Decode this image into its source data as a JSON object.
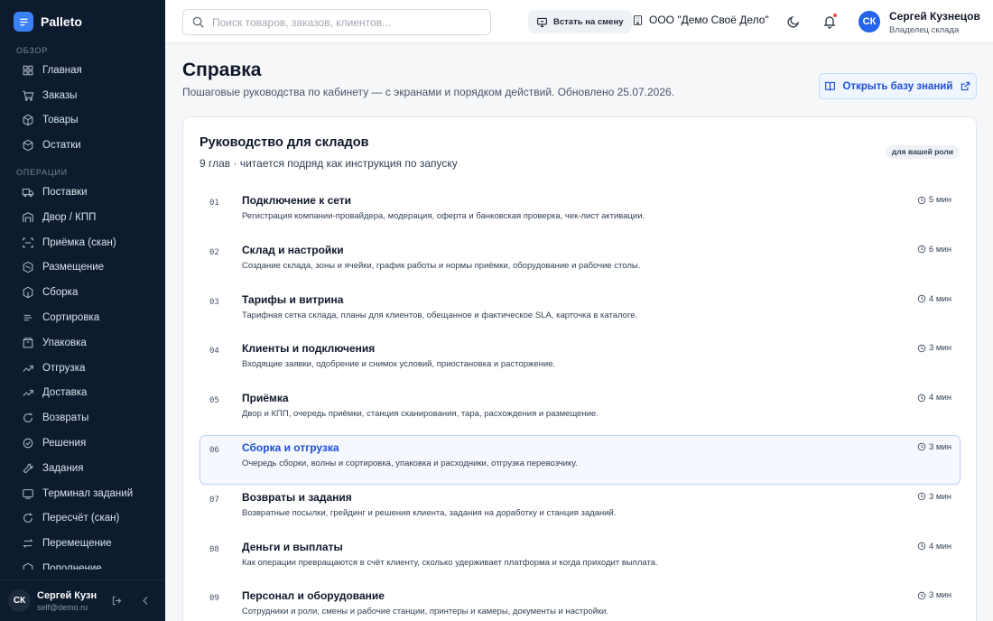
{
  "app": {
    "name": "Palleto"
  },
  "sidebar": {
    "sections": [
      {
        "label": "ОБЗОР",
        "items": [
          {
            "label": "Главная",
            "icon": "home-icon"
          },
          {
            "label": "Заказы",
            "icon": "cart-icon"
          },
          {
            "label": "Товары",
            "icon": "box-icon"
          },
          {
            "label": "Остатки",
            "icon": "stock-icon"
          }
        ]
      },
      {
        "label": "ОПЕРАЦИИ",
        "items": [
          {
            "label": "Поставки",
            "icon": "truck-icon"
          },
          {
            "label": "Двор / КПП",
            "icon": "gate-icon"
          },
          {
            "label": "Приёмка (скан)",
            "icon": "scan-icon"
          },
          {
            "label": "Размещение",
            "icon": "placement-icon"
          },
          {
            "label": "Сборка",
            "icon": "picking-icon"
          },
          {
            "label": "Сортировка",
            "icon": "sort-icon"
          },
          {
            "label": "Упаковка",
            "icon": "package-icon"
          },
          {
            "label": "Отгрузка",
            "icon": "shipment-icon"
          },
          {
            "label": "Доставка",
            "icon": "delivery-icon"
          },
          {
            "label": "Возвраты",
            "icon": "return-icon"
          },
          {
            "label": "Решения",
            "icon": "decision-icon"
          },
          {
            "label": "Задания",
            "icon": "task-icon"
          },
          {
            "label": "Терминал заданий",
            "icon": "terminal-icon"
          },
          {
            "label": "Пересчёт (скан)",
            "icon": "recount-icon"
          },
          {
            "label": "Перемещение",
            "icon": "transfer-icon"
          },
          {
            "label": "Пополнение",
            "icon": "replenish-icon"
          }
        ]
      }
    ],
    "user": {
      "initials": "СК",
      "name": "Сергей Кузнецов",
      "email": "self@demo.ru"
    }
  },
  "topbar": {
    "search_placeholder": "Поиск товаров, заказов, клиентов...",
    "shift_button": "Встать на смену",
    "org_name": "ООО \"Демо Своё Дело\"",
    "user": {
      "initials": "СК",
      "name": "Сергей Кузнецов",
      "role": "Владелец склада"
    }
  },
  "page": {
    "title": "Справка",
    "subtitle": "Пошаговые руководства по кабинету — с экранами и порядком действий. Обновлено 25.07.2026.",
    "kb_button": "Открыть базу знаний"
  },
  "guide": {
    "title": "Руководство для складов",
    "subtitle": "9 глав · читается подряд как инструкция по запуску",
    "role_badge": "для вашей роли",
    "chapters": [
      {
        "num": "01",
        "title": "Подключение к сети",
        "desc": "Регистрация компании-провайдера, модерация, оферта и банковская проверка, чек-лист активации.",
        "time": "5 мин"
      },
      {
        "num": "02",
        "title": "Склад и настройки",
        "desc": "Создание склада, зоны и ячейки, график работы и нормы приёмки, оборудование и рабочие столы.",
        "time": "6 мин"
      },
      {
        "num": "03",
        "title": "Тарифы и витрина",
        "desc": "Тарифная сетка склада, планы для клиентов, обещанное и фактическое SLA, карточка в каталоге.",
        "time": "4 мин"
      },
      {
        "num": "04",
        "title": "Клиенты и подключения",
        "desc": "Входящие заявки, одобрение и снимок условий, приостановка и расторжение.",
        "time": "3 мин"
      },
      {
        "num": "05",
        "title": "Приёмка",
        "desc": "Двор и КПП, очередь приёмки, станция сканирования, тара, расхождения и размещение.",
        "time": "4 мин"
      },
      {
        "num": "06",
        "title": "Сборка и отгрузка",
        "desc": "Очередь сборки, волны и сортировка, упаковка и расходники, отгрузка перевозчику.",
        "time": "3 мин",
        "active": true
      },
      {
        "num": "07",
        "title": "Возвраты и задания",
        "desc": "Возвратные посылки, грейдинг и решения клиента, задания на доработку и станция заданий.",
        "time": "3 мин"
      },
      {
        "num": "08",
        "title": "Деньги и выплаты",
        "desc": "Как операции превращаются в счёт клиенту, сколько удерживает платформа и когда приходит выплата.",
        "time": "4 мин"
      },
      {
        "num": "09",
        "title": "Персонал и оборудование",
        "desc": "Сотрудники и роли, смены и рабочие станции, принтеры и камеры, документы и настройки.",
        "time": "3 мин"
      }
    ]
  }
}
